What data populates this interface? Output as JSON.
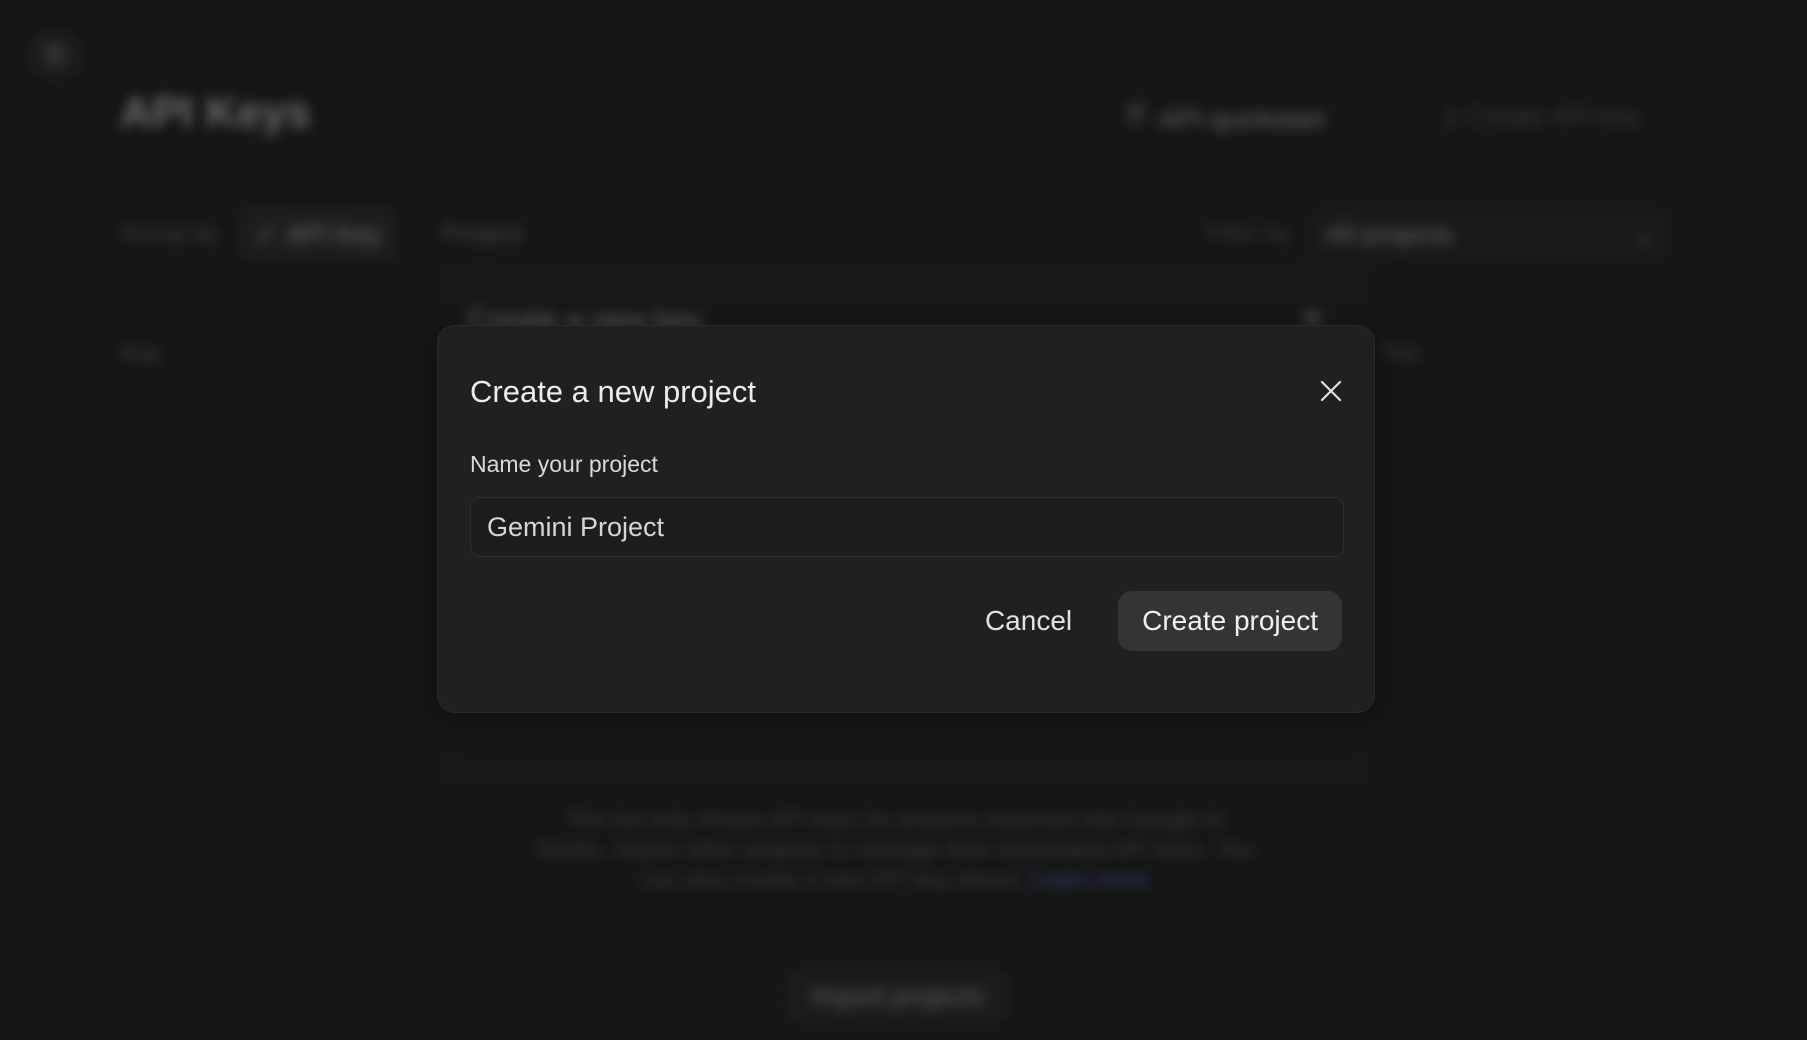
{
  "background": {
    "menu_icon": "menu-icon",
    "page_title": "API Keys",
    "quickstart_label": "API quickstart",
    "create_key_label": "Create API key",
    "group_by_label": "Group by",
    "group_by_options": [
      "API Key",
      "Project"
    ],
    "filter_by_label": "Filter by",
    "filter_value": "All projects",
    "columns": {
      "key": "Key",
      "tier": "Tier"
    },
    "underlying_modal_title": "Create a new key",
    "info_text": "This list only shows API keys for projects imported into Google AI Studio. Import other projects to manage their associated API keys. You can also create a new API key above.",
    "info_link": "Learn more",
    "import_button_label": "Import projects"
  },
  "dialog": {
    "title": "Create a new project",
    "name_label": "Name your project",
    "name_value": "Gemini Project",
    "cancel_label": "Cancel",
    "create_label": "Create project"
  }
}
